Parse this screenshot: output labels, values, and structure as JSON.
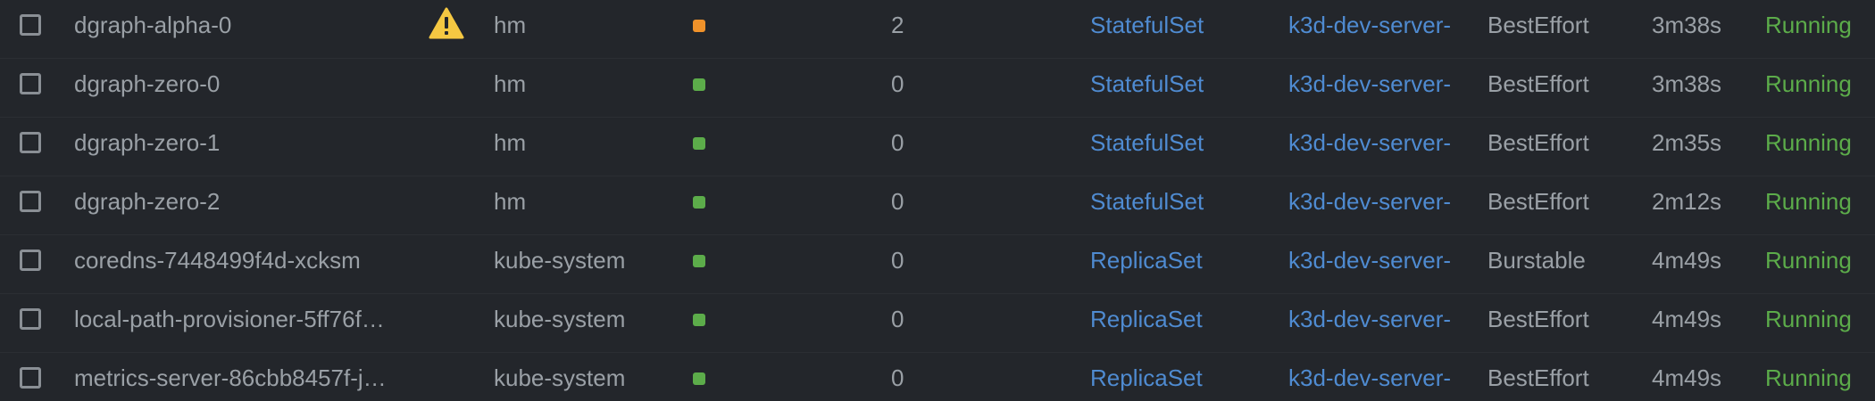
{
  "colors": {
    "background": "#23262b",
    "text": "#9aa0a6",
    "link": "#4f8bd1",
    "running": "#5cac4a",
    "status_ok": "#5cac4a",
    "status_warning": "#f0922a",
    "warning_icon": "#f5c842"
  },
  "rows": [
    {
      "name": "dgraph-alpha-0",
      "warning_icon": "warning-icon",
      "namespace": "hm",
      "status": "warning",
      "restarts": "2",
      "controlled_by": "StatefulSet",
      "node": "k3d-dev-server-",
      "qos": "BestEffort",
      "age": "3m38s",
      "phase": "Running"
    },
    {
      "name": "dgraph-zero-0",
      "namespace": "hm",
      "status": "ok",
      "restarts": "0",
      "controlled_by": "StatefulSet",
      "node": "k3d-dev-server-",
      "qos": "BestEffort",
      "age": "3m38s",
      "phase": "Running"
    },
    {
      "name": "dgraph-zero-1",
      "namespace": "hm",
      "status": "ok",
      "restarts": "0",
      "controlled_by": "StatefulSet",
      "node": "k3d-dev-server-",
      "qos": "BestEffort",
      "age": "2m35s",
      "phase": "Running"
    },
    {
      "name": "dgraph-zero-2",
      "namespace": "hm",
      "status": "ok",
      "restarts": "0",
      "controlled_by": "StatefulSet",
      "node": "k3d-dev-server-",
      "qos": "BestEffort",
      "age": "2m12s",
      "phase": "Running"
    },
    {
      "name": "coredns-7448499f4d-xcksm",
      "namespace": "kube-system",
      "status": "ok",
      "restarts": "0",
      "controlled_by": "ReplicaSet",
      "node": "k3d-dev-server-",
      "qos": "Burstable",
      "age": "4m49s",
      "phase": "Running"
    },
    {
      "name": "local-path-provisioner-5ff76f…",
      "namespace": "kube-system",
      "status": "ok",
      "restarts": "0",
      "controlled_by": "ReplicaSet",
      "node": "k3d-dev-server-",
      "qos": "BestEffort",
      "age": "4m49s",
      "phase": "Running"
    },
    {
      "name": "metrics-server-86cbb8457f-j…",
      "namespace": "kube-system",
      "status": "ok",
      "restarts": "0",
      "controlled_by": "ReplicaSet",
      "node": "k3d-dev-server-",
      "qos": "BestEffort",
      "age": "4m49s",
      "phase": "Running"
    }
  ]
}
